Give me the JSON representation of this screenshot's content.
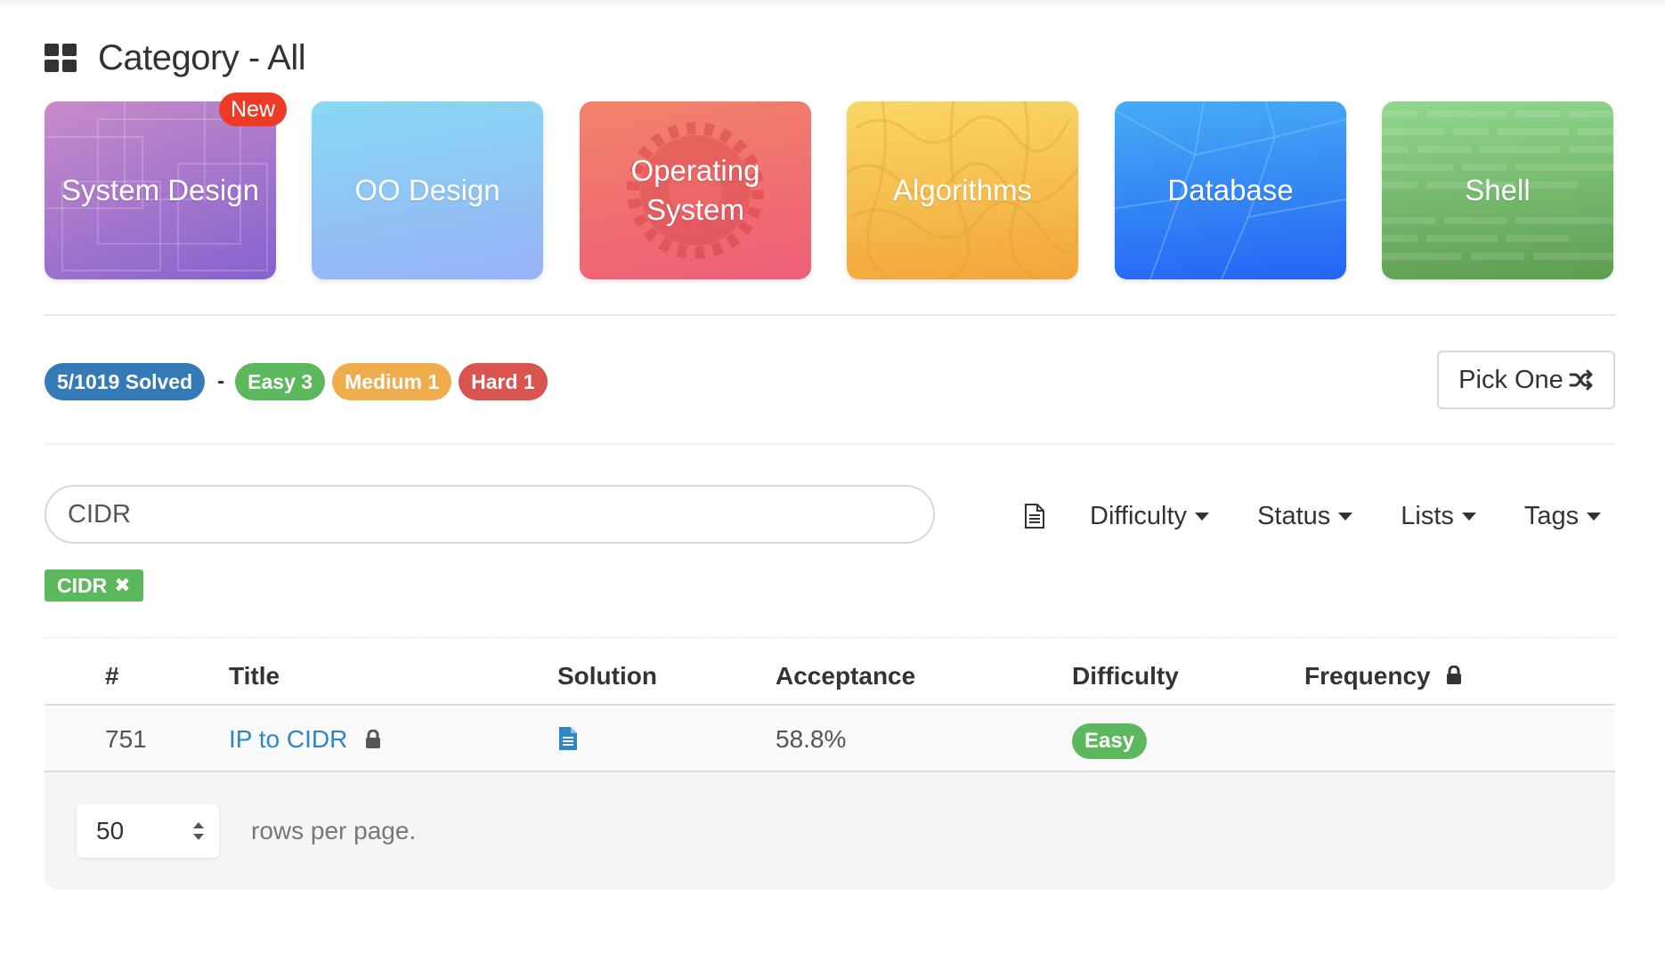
{
  "header": {
    "title": "Category - All",
    "icon": "grid-icon"
  },
  "categories": [
    {
      "label": "System Design",
      "badge": "New",
      "colors": [
        "#c389c6",
        "#8764cf"
      ]
    },
    {
      "label": "OO Design",
      "colors": [
        "#87d8f2",
        "#97b3f5"
      ]
    },
    {
      "label": "Operating System",
      "colors": [
        "#f2806b",
        "#ee6077"
      ]
    },
    {
      "label": "Algorithms",
      "colors": [
        "#f7d461",
        "#f3a63c"
      ]
    },
    {
      "label": "Database",
      "colors": [
        "#45a9f4",
        "#2467f5"
      ]
    },
    {
      "label": "Shell",
      "colors": [
        "#8cd48a",
        "#5e9f50"
      ]
    }
  ],
  "stats": {
    "solved": "5/1019 Solved",
    "separator": "-",
    "easy": "Easy 3",
    "medium": "Medium 1",
    "hard": "Hard 1"
  },
  "pick_one": {
    "label": "Pick One",
    "icon": "shuffle-icon"
  },
  "search": {
    "value": "CIDR",
    "placeholder": ""
  },
  "filters": {
    "difficulty": "Difficulty",
    "status": "Status",
    "lists": "Lists",
    "tags": "Tags"
  },
  "active_tag": {
    "label": "CIDR",
    "remove": "✖"
  },
  "table": {
    "headers": {
      "num": "#",
      "title": "Title",
      "solution": "Solution",
      "acceptance": "Acceptance",
      "difficulty": "Difficulty",
      "frequency": "Frequency"
    },
    "rows": [
      {
        "num": "751",
        "title": "IP to CIDR",
        "acceptance": "58.8%",
        "difficulty": "Easy"
      }
    ]
  },
  "pagination": {
    "rows_per_page_value": "50",
    "rows_per_page_label": "rows per page."
  },
  "colors": {
    "blue": "#337ab7",
    "easy": "#5cb85c",
    "medium": "#f0ad4e",
    "hard": "#d9534f",
    "link": "#2f86c7",
    "new_badge": "#ee3b28"
  }
}
